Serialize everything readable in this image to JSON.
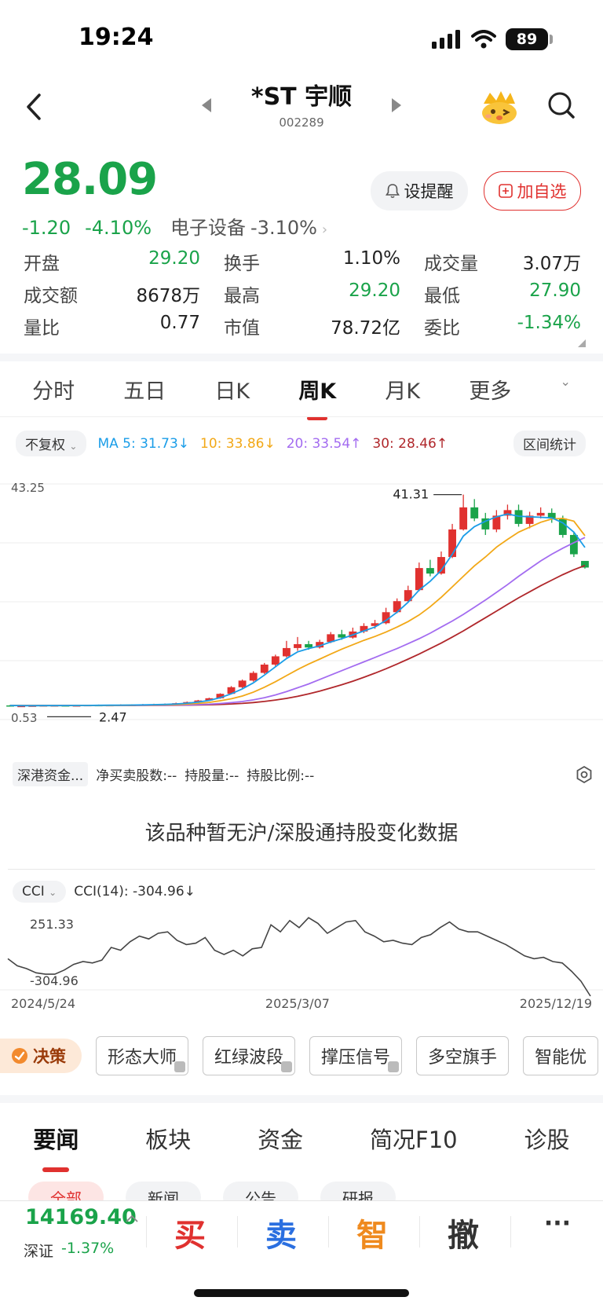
{
  "status": {
    "time": "19:24",
    "battery": "89"
  },
  "header": {
    "title": "*ST 宇顺",
    "code": "002289"
  },
  "quote": {
    "price": "28.09",
    "change": "-1.20",
    "change_pct": "-4.10%",
    "sector": "电子设备",
    "sector_pct": "-3.10%",
    "alert_label": "设提醒",
    "watch_label": "加自选"
  },
  "stats": [
    [
      {
        "label": "开盘",
        "value": "29.20",
        "color": "#1aa34a"
      },
      {
        "label": "换手",
        "value": "1.10%",
        "color": "#222222"
      },
      {
        "label": "成交量",
        "value": "3.07万",
        "color": "#222222"
      }
    ],
    [
      {
        "label": "成交额",
        "value": "8678万",
        "color": "#222222"
      },
      {
        "label": "最高",
        "value": "29.20",
        "color": "#1aa34a"
      },
      {
        "label": "最低",
        "value": "27.90",
        "color": "#1aa34a"
      }
    ],
    [
      {
        "label": "量比",
        "value": "0.77",
        "color": "#222222"
      },
      {
        "label": "市值",
        "value": "78.72亿",
        "color": "#222222"
      },
      {
        "label": "委比",
        "value": "-1.34%",
        "color": "#1aa34a"
      }
    ]
  ],
  "period_tabs": [
    "分时",
    "五日",
    "日K",
    "周K",
    "月K",
    "更多"
  ],
  "active_period": 3,
  "ma": {
    "adjust": "不复权",
    "ma5": "MA 5: 31.73↓",
    "ma10": "10: 33.86↓",
    "ma20": "20: 33.54↑",
    "ma30": "30: 28.46↑",
    "range_stat": "区间统计",
    "colors": {
      "ma5": "#1a9de8",
      "ma10": "#f2a817",
      "ma20": "#a36cf0",
      "ma30": "#b0272b"
    }
  },
  "kline_labels": {
    "top": "43.25",
    "high": "41.31",
    "bottom": "0.53",
    "low": "2.47"
  },
  "hk": {
    "source": "深港资金...",
    "net": "净买卖股数:--",
    "hold": "持股量:--",
    "ratio": "持股比例:--",
    "message": "该品种暂无沪/深股通持股变化数据"
  },
  "cci": {
    "selector": "CCI",
    "value": "CCI(14): -304.96↓",
    "top": "251.33",
    "bottom": "-304.96"
  },
  "dates": [
    "2024/5/24",
    "2025/3/07",
    "2025/12/19"
  ],
  "tools": {
    "decision": "决策",
    "items": [
      "形态大师",
      "红绿波段",
      "撑压信号",
      "多空旗手",
      "智能优"
    ]
  },
  "news_tabs": [
    "要闻",
    "板块",
    "资金",
    "简况F10",
    "诊股"
  ],
  "sub_tabs": [
    "全部",
    "新闻",
    "公告",
    "研报"
  ],
  "bottom": {
    "index_value": "14169.40",
    "index_name": "深证",
    "index_pct": "-1.37%",
    "buy": "买",
    "sell": "卖",
    "smart": "智",
    "cancel": "撤",
    "more": "···"
  },
  "chart_data": {
    "type": "candlestick",
    "period": "weekly",
    "ylim": [
      0.53,
      43.25
    ],
    "high_marker": 41.31,
    "low_marker": 2.47,
    "candles": [
      [
        3.1,
        3.0,
        3.2,
        2.9
      ],
      [
        3.0,
        3.0,
        3.1,
        2.9
      ],
      [
        3.0,
        3.05,
        3.1,
        2.95
      ],
      [
        3.05,
        3.1,
        3.2,
        3.0
      ],
      [
        3.1,
        3.1,
        3.2,
        3.0
      ],
      [
        3.1,
        3.05,
        3.15,
        3.0
      ],
      [
        3.05,
        3.1,
        3.2,
        3.0
      ],
      [
        3.1,
        3.15,
        3.2,
        3.05
      ],
      [
        3.15,
        3.1,
        3.25,
        3.05
      ],
      [
        3.1,
        3.15,
        3.2,
        3.05
      ],
      [
        3.15,
        3.2,
        3.3,
        3.1
      ],
      [
        3.2,
        3.2,
        3.3,
        3.1
      ],
      [
        3.2,
        3.25,
        3.35,
        3.15
      ],
      [
        3.25,
        3.3,
        3.4,
        3.2
      ],
      [
        3.3,
        3.35,
        3.45,
        3.25
      ],
      [
        3.35,
        3.5,
        3.6,
        3.3
      ],
      [
        3.5,
        3.7,
        3.8,
        3.45
      ],
      [
        3.7,
        4.0,
        4.1,
        3.65
      ],
      [
        4.0,
        4.4,
        4.5,
        3.95
      ],
      [
        4.4,
        5.2,
        5.3,
        4.3
      ],
      [
        5.2,
        6.4,
        6.6,
        5.1
      ],
      [
        6.4,
        7.6,
        7.8,
        6.2
      ],
      [
        7.6,
        9.0,
        9.3,
        7.4
      ],
      [
        9.0,
        10.5,
        10.8,
        8.8
      ],
      [
        10.5,
        12.0,
        12.3,
        10.2
      ],
      [
        12.0,
        13.5,
        14.8,
        11.8
      ],
      [
        13.5,
        14.2,
        15.5,
        13.0
      ],
      [
        14.2,
        13.6,
        14.8,
        13.2
      ],
      [
        13.6,
        14.6,
        15.0,
        13.4
      ],
      [
        14.6,
        16.0,
        16.4,
        14.4
      ],
      [
        16.0,
        15.4,
        16.8,
        15.0
      ],
      [
        15.4,
        16.5,
        17.2,
        15.2
      ],
      [
        16.5,
        17.5,
        18.0,
        16.2
      ],
      [
        17.5,
        18.0,
        18.6,
        17.0
      ],
      [
        18.0,
        20.0,
        20.8,
        17.8
      ],
      [
        20.0,
        22.0,
        22.5,
        19.8
      ],
      [
        22.0,
        24.0,
        24.8,
        21.8
      ],
      [
        24.0,
        28.0,
        29.0,
        23.8
      ],
      [
        28.0,
        27.0,
        29.5,
        26.5
      ],
      [
        27.0,
        30.0,
        31.0,
        26.8
      ],
      [
        30.0,
        35.0,
        36.0,
        29.8
      ],
      [
        35.0,
        39.0,
        41.31,
        34.8
      ],
      [
        39.0,
        37.0,
        40.5,
        36.5
      ],
      [
        37.0,
        35.0,
        38.0,
        34.0
      ],
      [
        35.0,
        37.5,
        38.5,
        34.5
      ],
      [
        37.5,
        38.5,
        39.5,
        36.8
      ],
      [
        38.5,
        36.0,
        39.5,
        35.5
      ],
      [
        36.0,
        37.5,
        38.2,
        35.2
      ],
      [
        37.5,
        38.0,
        39.0,
        37.0
      ],
      [
        38.0,
        37.0,
        38.8,
        36.2
      ],
      [
        37.0,
        34.0,
        37.5,
        33.5
      ],
      [
        34.0,
        30.5,
        34.5,
        30.0
      ],
      [
        29.29,
        28.09,
        29.2,
        27.9
      ]
    ],
    "ma5": [
      3.1,
      3.05,
      3.05,
      3.06,
      3.07,
      3.08,
      3.1,
      3.1,
      3.12,
      3.13,
      3.15,
      3.17,
      3.2,
      3.23,
      3.28,
      3.36,
      3.5,
      3.7,
      4.0,
      4.5,
      5.2,
      6.1,
      7.2,
      8.6,
      10.1,
      11.6,
      12.8,
      13.4,
      13.9,
      14.6,
      15.2,
      15.9,
      16.6,
      17.3,
      18.5,
      20.0,
      21.8,
      24.0,
      25.6,
      27.6,
      30.5,
      33.8,
      35.5,
      36.5,
      37.3,
      37.8,
      37.4,
      37.3,
      37.2,
      37.1,
      36.2,
      34.5,
      31.73
    ],
    "ma10": [
      3.1,
      3.08,
      3.07,
      3.07,
      3.07,
      3.07,
      3.08,
      3.08,
      3.09,
      3.1,
      3.12,
      3.14,
      3.16,
      3.19,
      3.22,
      3.27,
      3.35,
      3.47,
      3.65,
      3.95,
      4.3,
      4.8,
      5.5,
      6.4,
      7.4,
      8.5,
      9.6,
      10.6,
      11.5,
      12.4,
      13.3,
      14.1,
      14.9,
      15.6,
      16.4,
      17.3,
      18.3,
      19.5,
      21.0,
      22.7,
      24.6,
      26.5,
      28.4,
      30.0,
      31.8,
      33.2,
      34.5,
      35.4,
      36.3,
      36.9,
      37.0,
      36.5,
      33.86
    ],
    "ma20": [
      3.1,
      3.09,
      3.08,
      3.08,
      3.08,
      3.08,
      3.08,
      3.08,
      3.09,
      3.09,
      3.1,
      3.11,
      3.12,
      3.13,
      3.15,
      3.17,
      3.2,
      3.25,
      3.32,
      3.45,
      3.6,
      3.8,
      4.1,
      4.5,
      5.0,
      5.6,
      6.3,
      7.0,
      7.8,
      8.6,
      9.4,
      10.2,
      11.0,
      11.8,
      12.6,
      13.4,
      14.3,
      15.2,
      16.2,
      17.3,
      18.4,
      19.6,
      20.9,
      22.2,
      23.6,
      25.0,
      26.5,
      27.9,
      29.3,
      30.5,
      31.6,
      32.6,
      33.54
    ],
    "ma30": [
      3.1,
      3.1,
      3.09,
      3.09,
      3.09,
      3.09,
      3.09,
      3.09,
      3.09,
      3.09,
      3.1,
      3.1,
      3.11,
      3.11,
      3.12,
      3.13,
      3.15,
      3.18,
      3.22,
      3.28,
      3.36,
      3.47,
      3.62,
      3.82,
      4.07,
      4.38,
      4.75,
      5.2,
      5.7,
      6.25,
      6.85,
      7.5,
      8.2,
      8.95,
      9.75,
      10.6,
      11.5,
      12.4,
      13.4,
      14.4,
      15.5,
      16.6,
      17.8,
      19.0,
      20.2,
      21.4,
      22.6,
      23.7,
      24.8,
      25.8,
      26.8,
      27.7,
      28.46
    ]
  },
  "cci_data": {
    "type": "line",
    "ylim": [
      -304.96,
      251.33
    ],
    "values": [
      -40,
      -90,
      -110,
      -140,
      -150,
      -150,
      -120,
      -80,
      -60,
      -70,
      -50,
      40,
      20,
      80,
      120,
      100,
      140,
      150,
      90,
      60,
      70,
      110,
      20,
      -10,
      20,
      -20,
      30,
      40,
      200,
      150,
      230,
      180,
      250,
      210,
      140,
      180,
      220,
      230,
      150,
      120,
      80,
      90,
      70,
      60,
      110,
      130,
      180,
      220,
      170,
      150,
      150,
      120,
      90,
      60,
      20,
      -20,
      -40,
      -30,
      -60,
      -70,
      -130,
      -200,
      -304.96
    ]
  }
}
